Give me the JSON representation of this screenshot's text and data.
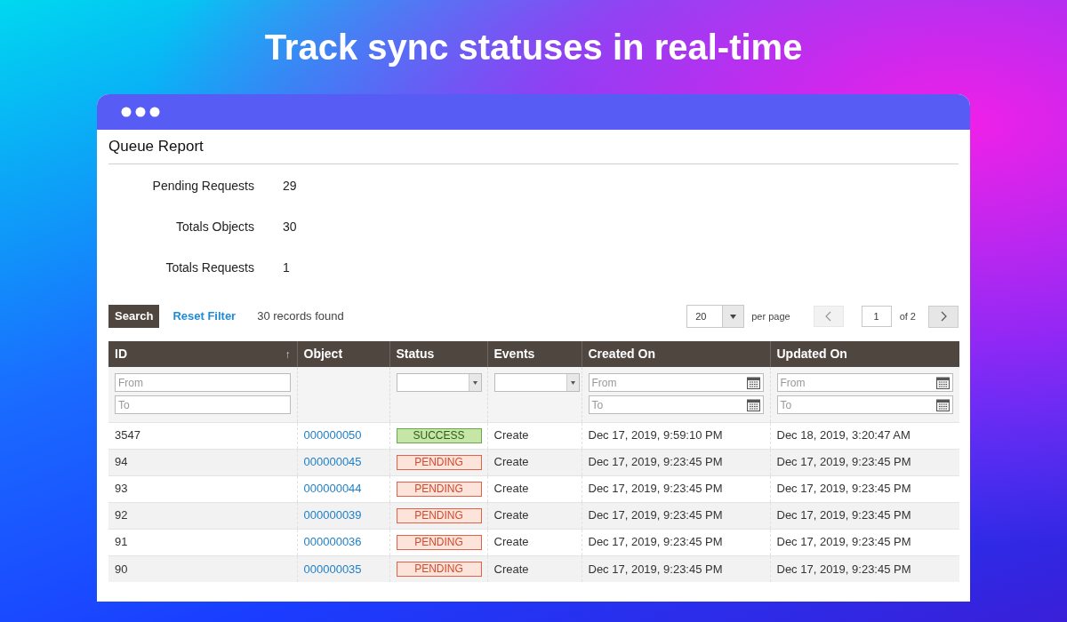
{
  "headline": "Track sync statuses in real-time",
  "window": {
    "title": "Queue Report"
  },
  "stats": [
    {
      "label": "Pending Requests",
      "value": "29"
    },
    {
      "label": "Totals Objects",
      "value": "30"
    },
    {
      "label": "Totals Requests",
      "value": "1"
    }
  ],
  "toolbar": {
    "search_button": "Search",
    "reset_link": "Reset Filter",
    "records_found": "30 records found",
    "per_page_value": "20",
    "per_page_label": "per page",
    "page_value": "1",
    "page_total": "of 2",
    "prev_disabled": true
  },
  "table": {
    "columns": [
      {
        "label": "ID",
        "sort": "↑",
        "filter": {
          "kind": "range",
          "from": "From",
          "to": "To"
        }
      },
      {
        "label": "Object"
      },
      {
        "label": "Status",
        "filter": {
          "kind": "select"
        }
      },
      {
        "label": "Events",
        "filter": {
          "kind": "select"
        }
      },
      {
        "label": "Created On",
        "filter": {
          "kind": "date",
          "from": "From",
          "to": "To"
        }
      },
      {
        "label": "Updated On",
        "filter": {
          "kind": "date",
          "from": "From",
          "to": "To"
        }
      }
    ],
    "rows": [
      {
        "id": "3547",
        "object": "000000050",
        "status": {
          "text": "SUCCESS",
          "kind": "success"
        },
        "event": "Create",
        "created": "Dec 17, 2019, 9:59:10 PM",
        "updated": "Dec 18, 2019, 3:20:47 AM"
      },
      {
        "id": "94",
        "object": "000000045",
        "status": {
          "text": "PENDING",
          "kind": "pending"
        },
        "event": "Create",
        "created": "Dec 17, 2019, 9:23:45 PM",
        "updated": "Dec 17, 2019, 9:23:45 PM"
      },
      {
        "id": "93",
        "object": "000000044",
        "status": {
          "text": "PENDING",
          "kind": "pending"
        },
        "event": "Create",
        "created": "Dec 17, 2019, 9:23:45 PM",
        "updated": "Dec 17, 2019, 9:23:45 PM"
      },
      {
        "id": "92",
        "object": "000000039",
        "status": {
          "text": "PENDING",
          "kind": "pending"
        },
        "event": "Create",
        "created": "Dec 17, 2019, 9:23:45 PM",
        "updated": "Dec 17, 2019, 9:23:45 PM"
      },
      {
        "id": "91",
        "object": "000000036",
        "status": {
          "text": "PENDING",
          "kind": "pending"
        },
        "event": "Create",
        "created": "Dec 17, 2019, 9:23:45 PM",
        "updated": "Dec 17, 2019, 9:23:45 PM"
      },
      {
        "id": "90",
        "object": "000000035",
        "status": {
          "text": "PENDING",
          "kind": "pending"
        },
        "event": "Create",
        "created": "Dec 17, 2019, 9:23:45 PM",
        "updated": "Dec 17, 2019, 9:23:45 PM"
      }
    ]
  }
}
